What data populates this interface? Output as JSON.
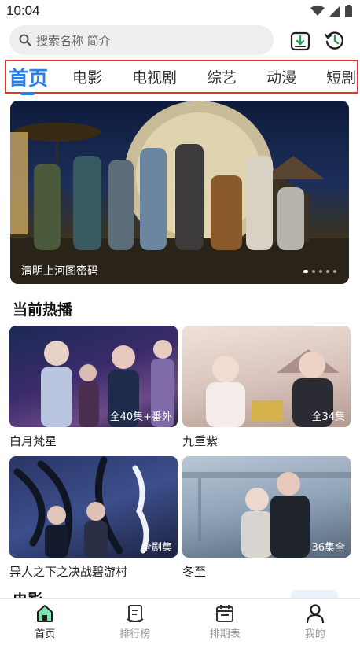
{
  "status": {
    "time": "10:04"
  },
  "search": {
    "placeholder": "搜索名称 简介"
  },
  "icons": {
    "search": "search-icon",
    "download": "download-icon",
    "history": "history-icon",
    "wifi": "wifi-icon",
    "signal": "signal-icon",
    "battery": "battery-icon"
  },
  "tabs": [
    {
      "label": "首页",
      "active": true
    },
    {
      "label": "电影",
      "active": false
    },
    {
      "label": "电视剧",
      "active": false
    },
    {
      "label": "综艺",
      "active": false
    },
    {
      "label": "动漫",
      "active": false
    },
    {
      "label": "短剧",
      "active": false
    }
  ],
  "banner": {
    "caption": "清明上河图密码",
    "slides": 5,
    "current": 0
  },
  "current_section": {
    "title": "当前热播"
  },
  "shows": [
    {
      "title": "白月梵星",
      "badge": "全40集+番外"
    },
    {
      "title": "九重紫",
      "badge": "全34集"
    },
    {
      "title": "异人之下之决战碧游村",
      "badge": "全剧集"
    },
    {
      "title": "冬至",
      "badge": "36集全"
    }
  ],
  "next_section": {
    "title": "电影"
  },
  "bottom_nav": [
    {
      "label": "首页",
      "icon": "home-icon",
      "active": true
    },
    {
      "label": "排行榜",
      "icon": "ranking-icon",
      "active": false
    },
    {
      "label": "排期表",
      "icon": "calendar-icon",
      "active": false
    },
    {
      "label": "我的",
      "icon": "profile-icon",
      "active": false
    }
  ],
  "colors": {
    "accent": "#2b7de9",
    "highlight_border": "#e23333"
  }
}
